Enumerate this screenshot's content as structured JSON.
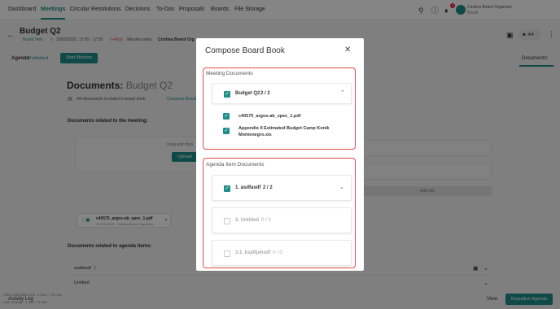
{
  "nav": {
    "items": [
      "Dashboard",
      "Meetings",
      "Circular Resolutions",
      "Decisions",
      "To-Dos",
      "Proposals",
      "Boards",
      "File Storage"
    ],
    "active": "Meetings",
    "notifications": "3",
    "user_name": "Cristina Board Organizer",
    "user_role": "Board"
  },
  "page": {
    "title": "Budget Q2",
    "board_tag": "Board Test",
    "datetime": "10/02/2025, 17:00 - 17:30",
    "duration": "(+45m)",
    "minutes_taker_label": "Minutes taker:",
    "minutes_taker": "Cristina Board Org",
    "agenda_tab": "Agenda",
    "agenda_status": "Published",
    "start_minutes": "Start Minutes",
    "documents_tab": "Documents",
    "documents_count": "2",
    "participants_count": "4/4"
  },
  "documents": {
    "heading": "Documents:",
    "meeting_name": "Budget Q2",
    "summary": "4/4 documents included in board book",
    "compose_link": "Compose Board Book",
    "related_meeting": "Documents related to the meeting:",
    "drag_drop": "Drag and drop",
    "upload": "Upload",
    "file_card_name": "c40575_argos-ab_spec_1.pdf",
    "file_card_meta": "12 Feb 2025 · Cristina Board Organizer",
    "related_agenda": "Documents related to agenda items:",
    "agenda_row_1": "asdfasdf",
    "agenda_row_1_count": "2",
    "agenda_row_2": "Untitled",
    "add_link": "Add link"
  },
  "modal": {
    "title": "Compose Board Book",
    "meeting_docs_label": "Meeting Documents",
    "meeting_group_name": "Budget Q2",
    "meeting_group_count": "2 / 2",
    "files": [
      "c40575_argos-ab_spec_1.pdf",
      "Appendix II Estimated Budget Camp Konik Montenegro.xls"
    ],
    "agenda_docs_label": "Agenda Item Documents",
    "agenda_items": [
      {
        "name": "1. asdfasdf",
        "count": "2 / 2",
        "checked": true
      },
      {
        "name": "2. Untitled",
        "count": "0 / 0",
        "checked": false
      },
      {
        "name": "3.1. ksjdfjahsdf",
        "count": "0 / 0",
        "checked": false
      }
    ]
  },
  "footer": {
    "activity_log": "Activity Log",
    "status_lines": [
      "Time until table lock: 1 Dec – 23 Jan",
      "Last change: 1 Jan – 2 Jan"
    ],
    "view": "View",
    "republish": "Republish Agenda"
  },
  "colors": {
    "accent": "#1f8f8a",
    "highlight": "#e24a4a"
  }
}
